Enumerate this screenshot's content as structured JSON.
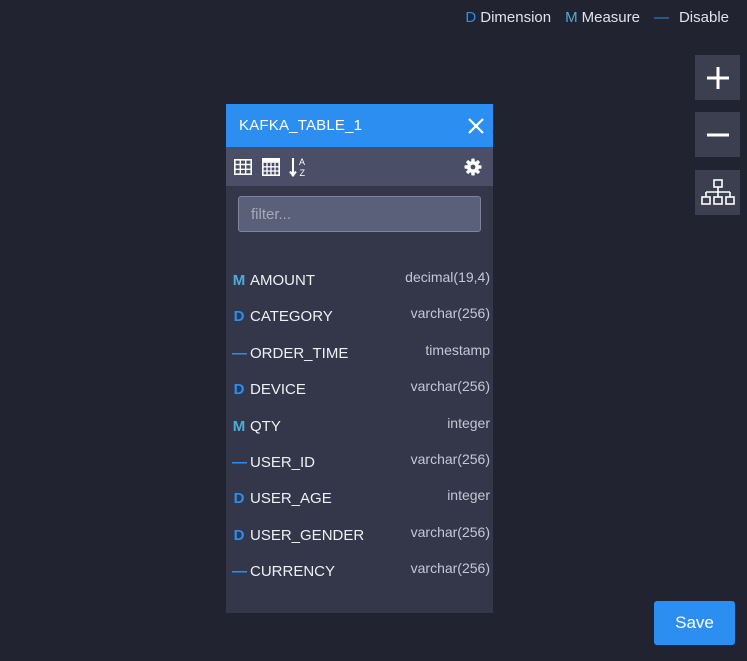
{
  "legend": {
    "dimension": {
      "mark": "D",
      "label": "Dimension"
    },
    "measure": {
      "mark": "M",
      "label": "Measure"
    },
    "disable": {
      "mark": "—",
      "label": "Disable"
    }
  },
  "tools": {
    "zoom_in_icon": "plus-icon",
    "zoom_out_icon": "minus-icon",
    "layout_icon": "hierarchy-icon"
  },
  "table": {
    "title": "KAFKA_TABLE_1",
    "filter_placeholder": "filter...",
    "filter_value": "",
    "columns": [
      {
        "kind": "M",
        "name": "AMOUNT",
        "type": "decimal(19,4)"
      },
      {
        "kind": "D",
        "name": "CATEGORY",
        "type": "varchar(256)"
      },
      {
        "kind": "—",
        "name": "ORDER_TIME",
        "type": "timestamp"
      },
      {
        "kind": "D",
        "name": "DEVICE",
        "type": "varchar(256)"
      },
      {
        "kind": "M",
        "name": "QTY",
        "type": "integer"
      },
      {
        "kind": "—",
        "name": "USER_ID",
        "type": "varchar(256)"
      },
      {
        "kind": "D",
        "name": "USER_AGE",
        "type": "integer"
      },
      {
        "kind": "D",
        "name": "USER_GENDER",
        "type": "varchar(256)"
      },
      {
        "kind": "—",
        "name": "CURRENCY",
        "type": "varchar(256)"
      }
    ]
  },
  "actions": {
    "save_label": "Save"
  },
  "colors": {
    "background": "#212330",
    "accent": "#2b8ef0",
    "measure": "#4aaed8",
    "card": "#34374a",
    "toolbar": "#4a4e66"
  }
}
